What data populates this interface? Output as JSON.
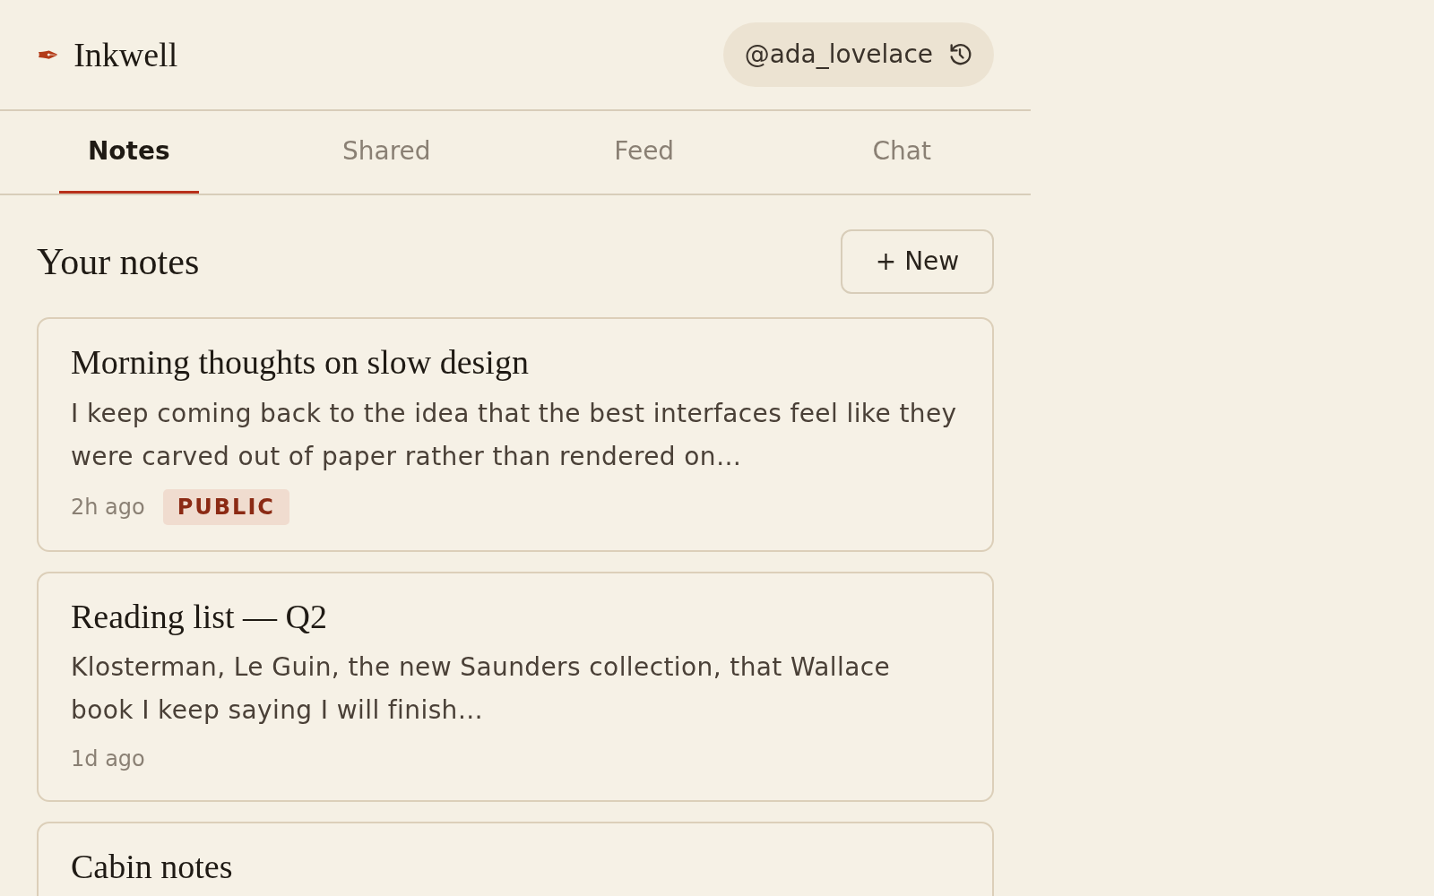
{
  "app": {
    "logo_glyph": "✒",
    "name": "Inkwell",
    "user": "@ada_lovelace"
  },
  "tabs": [
    {
      "label": "Notes",
      "selected": true
    },
    {
      "label": "Shared",
      "selected": false
    },
    {
      "label": "Feed",
      "selected": false
    },
    {
      "label": "Chat",
      "selected": false
    }
  ],
  "section": {
    "title": "Your notes",
    "new_button": "+ New"
  },
  "notes": [
    {
      "title": "Morning thoughts on slow design",
      "preview": "I keep coming back to the idea that the best interfaces feel like they were carved out of paper rather than rendered on…",
      "time": "2h ago",
      "badge": "PUBLIC"
    },
    {
      "title": "Reading list — Q2",
      "preview": "Klosterman, Le Guin, the new Saunders collection, that Wallace book I keep saying I will finish…",
      "time": "1d ago"
    },
    {
      "title": "Cabin notes"
    }
  ]
}
